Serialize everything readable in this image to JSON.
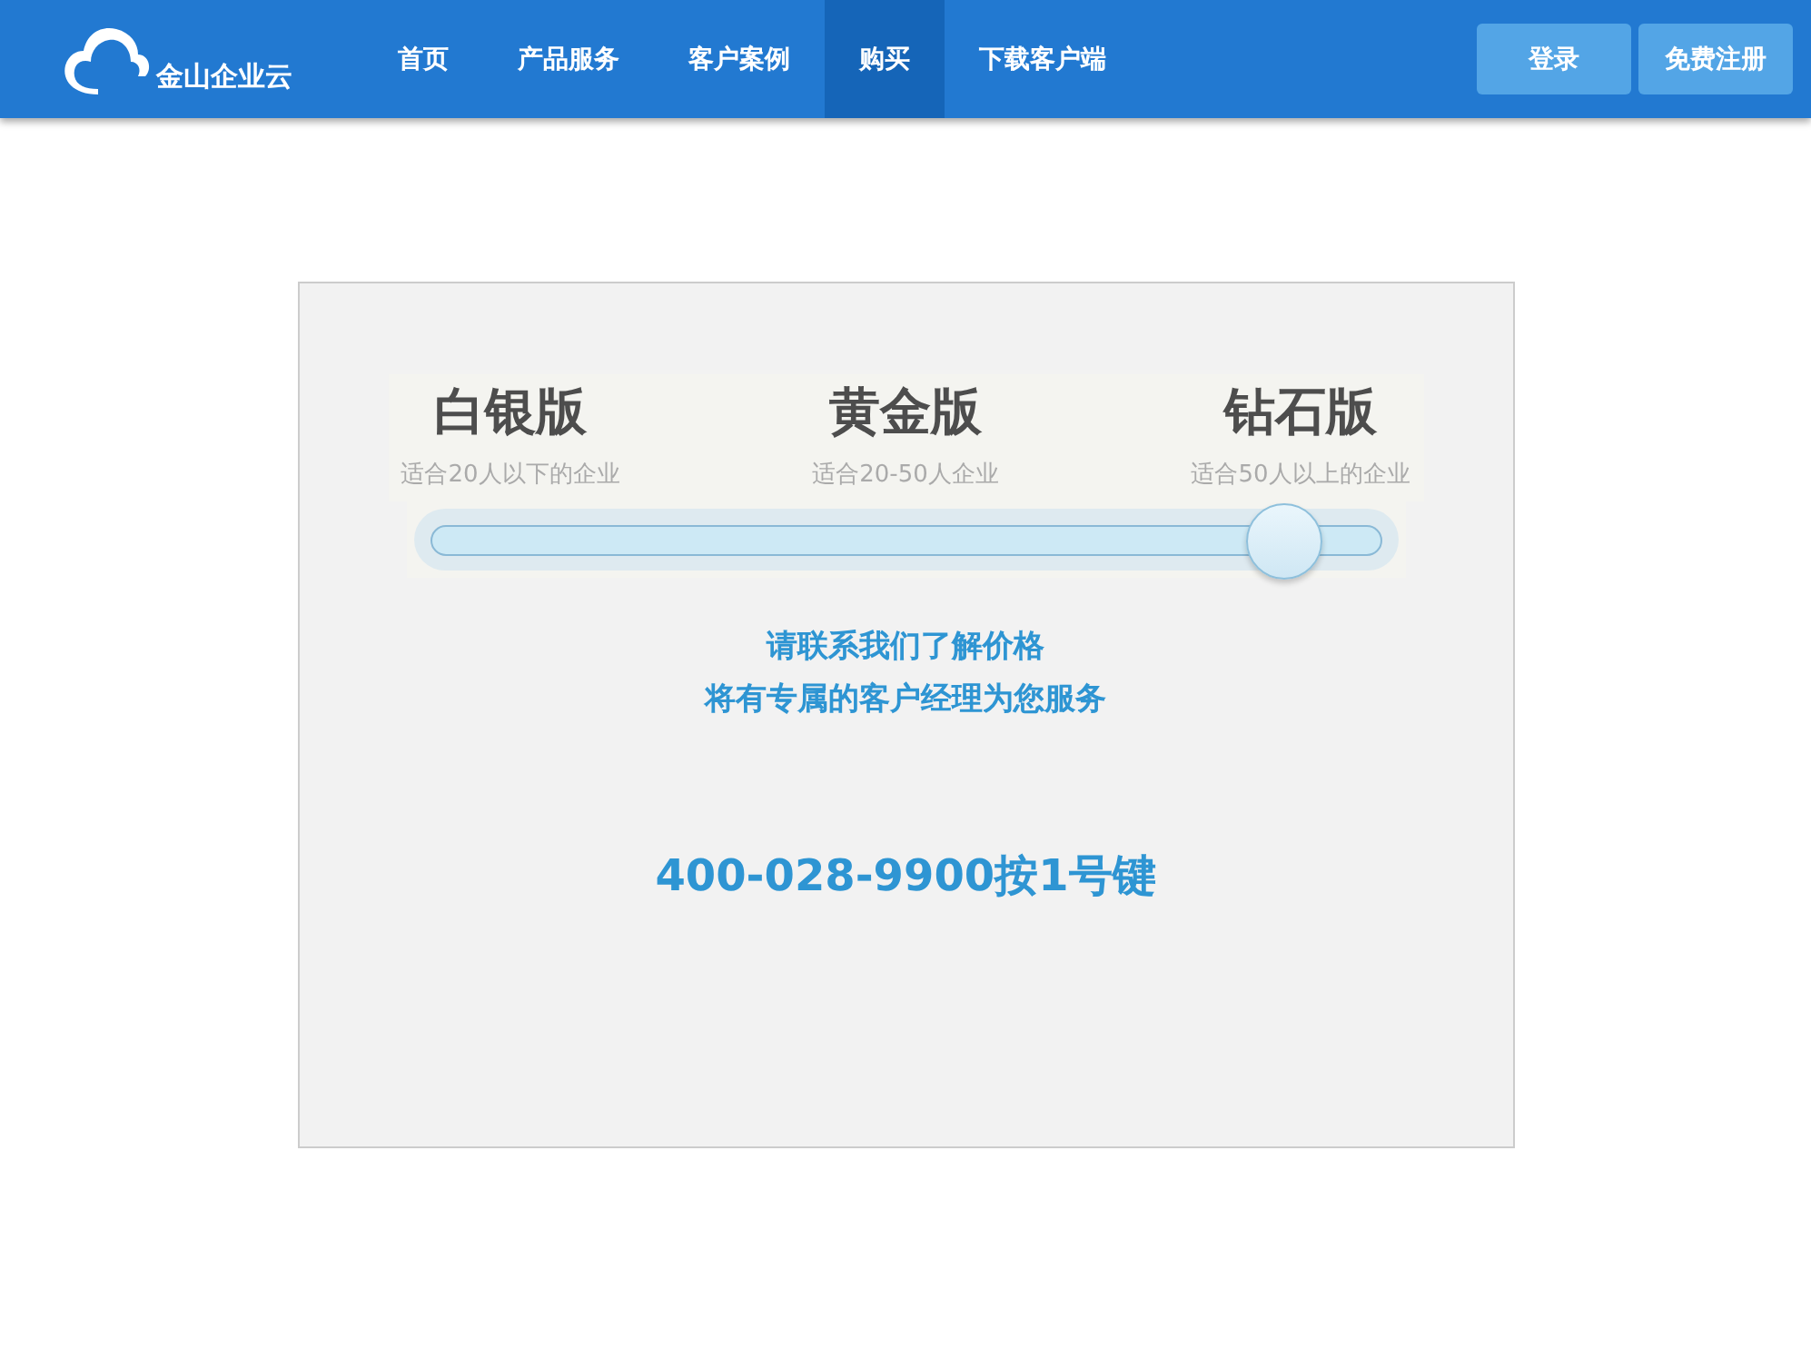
{
  "header": {
    "logo_text": "金山企业云",
    "nav": [
      {
        "label": "首页",
        "selected": false
      },
      {
        "label": "产品服务",
        "selected": false
      },
      {
        "label": "客户案例",
        "selected": false
      },
      {
        "label": "购买",
        "selected": true
      },
      {
        "label": "下载客户端",
        "selected": false
      }
    ],
    "buttons": [
      "登录",
      "免费注册"
    ]
  },
  "pricing": {
    "plans": [
      {
        "name": "白银版",
        "description": "适合20人以下的企业"
      },
      {
        "name": "黄金版",
        "description": "适合20-50人企业"
      },
      {
        "name": "钻石版",
        "description": "适合50人以上的企业"
      }
    ],
    "slider": {
      "level": 0.9
    },
    "message_lines": [
      "请联系我们了解价格",
      "将有专属的客户经理为您服务"
    ],
    "phone": "400-028-9900按1号键"
  }
}
